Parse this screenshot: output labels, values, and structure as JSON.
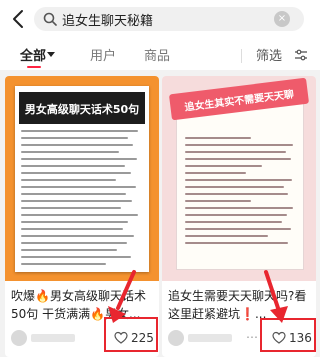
{
  "search": {
    "query": "追女生聊天秘籍",
    "clear_symbol": "×"
  },
  "tabs": [
    {
      "label": "全部",
      "active": true
    },
    {
      "label": "用户",
      "active": false
    },
    {
      "label": "商品",
      "active": false
    }
  ],
  "filter": {
    "label": "筛选"
  },
  "cards": [
    {
      "cover_title": "男女高级聊天话术50句",
      "title": "吹爆🔥男女高级聊天话术50句 干货满满🔥男女...",
      "likes": "225"
    },
    {
      "cover_title": "追女生其实不需要天天聊",
      "title": "追女生需要天天聊天吗?看这里赶紧避坑❗...",
      "likes": "136"
    }
  ],
  "colors": {
    "accent": "#ff2442",
    "annotation": "#e8262f",
    "cover1_bg": "#f4922f",
    "cover2_bg": "#f6dcdc"
  }
}
